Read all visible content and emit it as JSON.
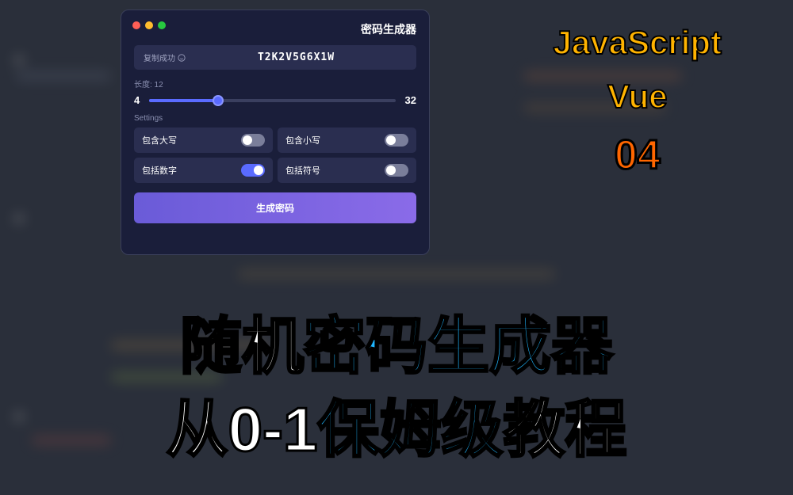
{
  "app": {
    "title": "密码生成器",
    "copy_status": "复制成功",
    "password": "T2K2V5G6X1W",
    "length_label": "长度: 12",
    "slider_min": "4",
    "slider_max": "32",
    "settings_label": "Settings",
    "settings": [
      {
        "label": "包含大写",
        "on": false
      },
      {
        "label": "包含小写",
        "on": false
      },
      {
        "label": "包括数字",
        "on": true
      },
      {
        "label": "包括符号",
        "on": false
      }
    ],
    "generate_btn": "生成密码"
  },
  "side": {
    "js": "JavaScript",
    "vue": "Vue",
    "num": "04"
  },
  "headline1": {
    "part1": "随机",
    "part2": "密码生成器"
  },
  "headline2": {
    "part1": "从0-1",
    "part2": "保姆级",
    "part3": "教程"
  }
}
